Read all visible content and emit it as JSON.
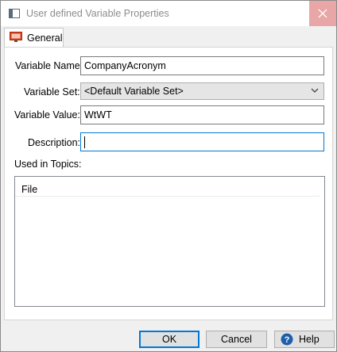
{
  "window": {
    "title": "User defined Variable Properties",
    "title_icon": "dialog-icon",
    "close_icon": "close-icon"
  },
  "tabs": [
    {
      "label": "General",
      "icon": "monitor-icon",
      "active": true
    }
  ],
  "form": {
    "variable_name_label": "Variable Name:",
    "variable_name_value": "CompanyAcronym",
    "variable_set_label": "Variable Set:",
    "variable_set_value": "<Default Variable Set>",
    "variable_value_label": "Variable Value:",
    "variable_value_value": "WtWT",
    "description_label": "Description:",
    "description_value": "",
    "used_in_topics_label": "Used in Topics:",
    "topics_column_header": "File"
  },
  "buttons": {
    "ok": "OK",
    "cancel": "Cancel",
    "help": "Help"
  },
  "colors": {
    "focus_border": "#0078d7",
    "close_hover": "#e8a6a6",
    "tab_icon": "#d9421c"
  }
}
